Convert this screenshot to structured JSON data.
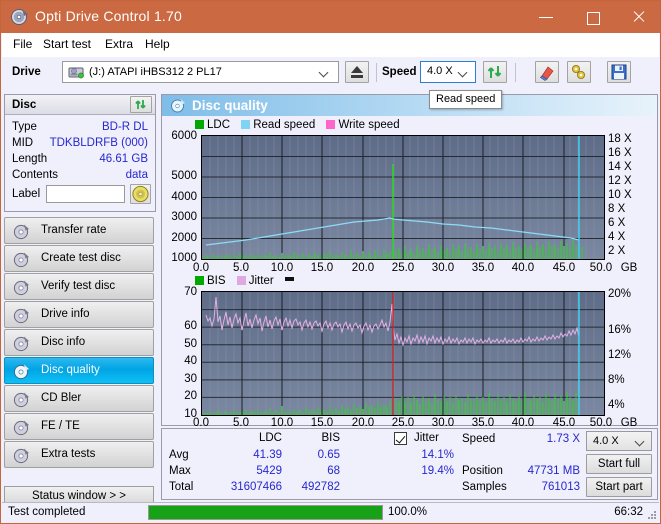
{
  "window": {
    "title": "Opti Drive Control 1.70",
    "icon": "disc-icon",
    "minimize": "minimize-icon",
    "maximize": "maximize-icon",
    "close": "close-icon"
  },
  "menu": {
    "items": [
      "File",
      "Start test",
      "Extra",
      "Help"
    ]
  },
  "toolbar": {
    "drive_label": "Drive",
    "drive_value": "(J:)   ATAPI iHBS312   2 PL17",
    "eject_icon": "eject-icon",
    "speed_label": "Speed",
    "speed_value": "4.0 X",
    "refresh_icon": "refresh-icon",
    "erase_icon": "eraser-icon",
    "tools_icon": "tools-icon",
    "save_icon": "save-icon",
    "tooltip": "Read speed"
  },
  "disc_panel": {
    "title": "Disc",
    "refresh_icon": "refresh-icon",
    "rows": [
      {
        "key": "Type",
        "value": "BD-R DL"
      },
      {
        "key": "MID",
        "value": "TDKBLDRFB (000)"
      },
      {
        "key": "Length",
        "value": "46.61 GB"
      },
      {
        "key": "Contents",
        "value": "data"
      }
    ],
    "label_key": "Label",
    "label_value": "",
    "label_icon": "disc-gold-icon"
  },
  "nav": {
    "items": [
      {
        "label": "Transfer rate",
        "icon": "disc-icon",
        "selected": false
      },
      {
        "label": "Create test disc",
        "icon": "disc-icon",
        "selected": false
      },
      {
        "label": "Verify test disc",
        "icon": "disc-icon",
        "selected": false
      },
      {
        "label": "Drive info",
        "icon": "disc-icon",
        "selected": false
      },
      {
        "label": "Disc info",
        "icon": "disc-icon",
        "selected": false
      },
      {
        "label": "Disc quality",
        "icon": "disc-icon",
        "selected": true
      },
      {
        "label": "CD Bler",
        "icon": "disc-icon",
        "selected": false
      },
      {
        "label": "FE / TE",
        "icon": "disc-icon",
        "selected": false
      },
      {
        "label": "Extra tests",
        "icon": "disc-icon",
        "selected": false
      }
    ],
    "status_window": "Status window > >"
  },
  "chart_panel": {
    "title": "Disc quality",
    "icon": "disc-icon"
  },
  "chart_data": [
    {
      "id": "top",
      "type": "line",
      "title": "Disc quality - LDC / Read speed",
      "legend": [
        {
          "label": "LDC",
          "color": "#00a800"
        },
        {
          "label": "Read speed",
          "color": "#7fd4f4"
        },
        {
          "label": "Write speed",
          "color": "#ff66cc"
        }
      ],
      "legend_position": "top-left",
      "grid": true,
      "xlabel": "GB",
      "x_ticks": [
        "0.0",
        "5.0",
        "10.0",
        "15.0",
        "20.0",
        "25.0",
        "30.0",
        "35.0",
        "40.0",
        "45.0",
        "50.0"
      ],
      "xlim": [
        0,
        50
      ],
      "ylabel_left": "LDC",
      "y_ticks_left": [
        "1000",
        "2000",
        "3000",
        "4000",
        "5000",
        "6000"
      ],
      "ylim_left": [
        0,
        6000
      ],
      "ylabel_right": "Speed",
      "y_ticks_right": [
        "2 X",
        "4 X",
        "6 X",
        "8 X",
        "10 X",
        "12 X",
        "14 X",
        "16 X",
        "18 X"
      ],
      "ylim_right": [
        0,
        18
      ],
      "series": [
        {
          "name": "Read speed",
          "color": "#7fd4f4",
          "x": [
            0.0,
            1.0,
            2.0,
            3.0,
            4.0,
            5.0,
            6.5,
            8.0,
            9.5,
            11.0,
            12.5,
            14.0,
            15.5,
            17.0,
            18.5,
            20.0,
            21.5,
            23.0,
            23.4,
            25.0,
            26.5,
            28.0,
            30.0,
            32.0,
            34.0,
            36.0,
            38.0,
            40.0,
            42.0,
            44.0,
            46.0,
            46.9
          ],
          "y": [
            2.1,
            2.2,
            2.3,
            2.4,
            2.5,
            2.6,
            2.8,
            3.0,
            3.1,
            3.25,
            3.4,
            3.5,
            3.6,
            3.7,
            3.8,
            3.9,
            3.95,
            4.0,
            3.95,
            3.85,
            3.8,
            3.75,
            3.65,
            3.55,
            3.45,
            3.35,
            3.25,
            3.1,
            2.95,
            2.8,
            2.6,
            2.5
          ]
        },
        {
          "name": "LDC",
          "color": "#2fd424",
          "note": "dense error bars along bottom, spike to ~5430 at 23.4 GB",
          "spike_x": 23.4,
          "spike_y": 5429,
          "baseline": 120
        }
      ],
      "markers": [
        {
          "name": "end-of-data-line",
          "x": 46.9,
          "color": "#39d6f7"
        }
      ]
    },
    {
      "id": "bottom",
      "type": "line",
      "title": "Disc quality - BIS / Jitter",
      "legend": [
        {
          "label": "BIS",
          "color": "#00a800"
        },
        {
          "label": "Jitter",
          "color": "#e0a8e0"
        }
      ],
      "legend_position": "top-left",
      "grid": true,
      "xlabel": "GB",
      "x_ticks": [
        "0.0",
        "5.0",
        "10.0",
        "15.0",
        "20.0",
        "25.0",
        "30.0",
        "35.0",
        "40.0",
        "45.0",
        "50.0"
      ],
      "xlim": [
        0,
        50
      ],
      "ylabel_left": "BIS",
      "y_ticks_left": [
        "10",
        "20",
        "30",
        "40",
        "50",
        "60",
        "70"
      ],
      "ylim_left": [
        0,
        70
      ],
      "ylabel_right": "Jitter",
      "y_ticks_right": [
        "4%",
        "8%",
        "12%",
        "16%",
        "20%"
      ],
      "ylim_right": [
        0,
        20
      ],
      "series": [
        {
          "name": "Jitter",
          "color": "#e0a8e0",
          "x": [
            0.0,
            1.0,
            2.0,
            3.0,
            4.5,
            6.0,
            7.5,
            9.0,
            10.5,
            12.0,
            13.5,
            15.0,
            16.5,
            18.0,
            19.5,
            21.0,
            22.5,
            23.3,
            23.5,
            24.5,
            26.0,
            28.0,
            30.0,
            32.0,
            34.0,
            36.0,
            38.0,
            40.0,
            42.0,
            43.5,
            45.0,
            46.0,
            46.8
          ],
          "y": [
            16.2,
            15.8,
            15.6,
            15.9,
            15.4,
            15.3,
            15.2,
            15.4,
            15.2,
            15.1,
            15.0,
            14.9,
            14.8,
            15.0,
            15.1,
            15.2,
            15.3,
            19.4,
            14.2,
            13.5,
            13.3,
            13.2,
            13.1,
            13.0,
            13.0,
            13.1,
            13.1,
            13.2,
            13.3,
            13.6,
            14.0,
            14.3,
            13.8
          ]
        },
        {
          "name": "BIS",
          "color": "#2fd424",
          "note": "dense error bars along bottom, rising after 23 GB",
          "baseline_before": 2,
          "baseline_after": 7
        }
      ],
      "markers": [
        {
          "name": "layer-break-line",
          "x": 23.3,
          "color": "#d01f1f"
        },
        {
          "name": "end-of-data-line",
          "x": 46.9,
          "color": "#39d6f7"
        }
      ]
    }
  ],
  "stats": {
    "col_headers": [
      "LDC",
      "BIS"
    ],
    "row_labels": [
      "Avg",
      "Max",
      "Total"
    ],
    "ldc": {
      "avg": "41.39",
      "max": "5429",
      "total": "31607466"
    },
    "bis": {
      "avg": "0.65",
      "max": "68",
      "total": "492782"
    },
    "jitter": {
      "label": "Jitter",
      "checked": true,
      "avg": "14.1%",
      "max": "19.4%"
    },
    "speed_key": "Speed",
    "speed_value": "1.73 X",
    "position_key": "Position",
    "position_value": "47731 MB",
    "samples_key": "Samples",
    "samples_value": "761013",
    "speed_select": "4.0 X",
    "start_full": "Start full",
    "start_part": "Start part"
  },
  "statusbar": {
    "message": "Test completed",
    "progress_percent": "100.0%",
    "progress_value": 100,
    "elapsed": "66:32"
  },
  "colors": {
    "titlebar": "#cb6a42",
    "accent_blue": "#2727d0",
    "plot_bg": "#6b7994",
    "selection": "#00a4e4",
    "progress": "#17a117",
    "ldc_green": "#2fd424",
    "read_speed": "#7fd4f4",
    "jitter_pink": "#e0a8e0",
    "layer_break": "#d01f1f",
    "end_marker": "#39d6f7"
  }
}
